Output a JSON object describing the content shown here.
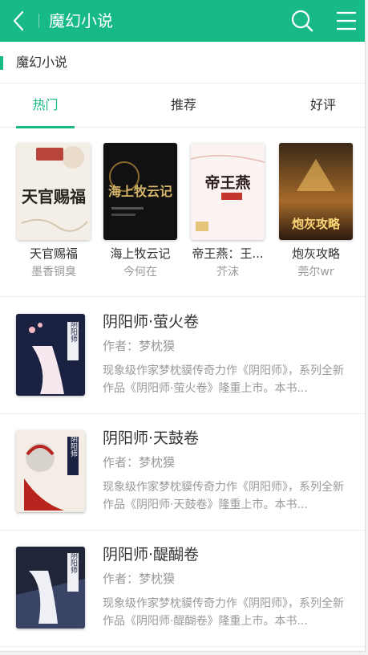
{
  "header": {
    "title": "魔幻小说",
    "back_icon": "chevron-left-icon",
    "search_icon": "search-icon",
    "menu_icon": "hamburger-menu-icon"
  },
  "section": {
    "label": "魔幻小说"
  },
  "tabs": [
    {
      "label": "热门",
      "active": true
    },
    {
      "label": "推荐",
      "active": false
    },
    {
      "label": "好评",
      "active": false
    }
  ],
  "grid": [
    {
      "title": "天官赐福",
      "author": "墨香铜臭",
      "cover_text": "天官赐福"
    },
    {
      "title": "海上牧云记",
      "author": "今何在",
      "cover_text": "海上牧云记"
    },
    {
      "title": "帝王燕：王...",
      "author": "芥沫",
      "cover_text": "帝王燕"
    },
    {
      "title": "炮灰攻略",
      "author": "莞尔wr",
      "cover_text": "炮灰攻略"
    }
  ],
  "list": [
    {
      "title": "阴阳师·萤火卷",
      "author": "作者：梦枕獏",
      "desc": "现象级作家梦枕貘传奇力作《阴阳师》，系列全新作品《阴阳师·萤火卷》隆重上市。本书...",
      "cover_text": "阴阳师"
    },
    {
      "title": "阴阳师·天鼓卷",
      "author": "作者：梦枕獏",
      "desc": "现象级作家梦枕貘传奇力作《阴阳师》，系列全新作品《阴阳师·天鼓卷》隆重上市。本书...",
      "cover_text": "阴阳师"
    },
    {
      "title": "阴阳师·醍醐卷",
      "author": "作者：梦枕獏",
      "desc": "现象级作家梦枕貘传奇力作《阴阳师》，系列全新作品《阴阳师·醍醐卷》隆重上市。本书...",
      "cover_text": "阴阳师"
    }
  ],
  "colors": {
    "accent": "#17b987",
    "text": "#333333",
    "muted": "#999999"
  }
}
